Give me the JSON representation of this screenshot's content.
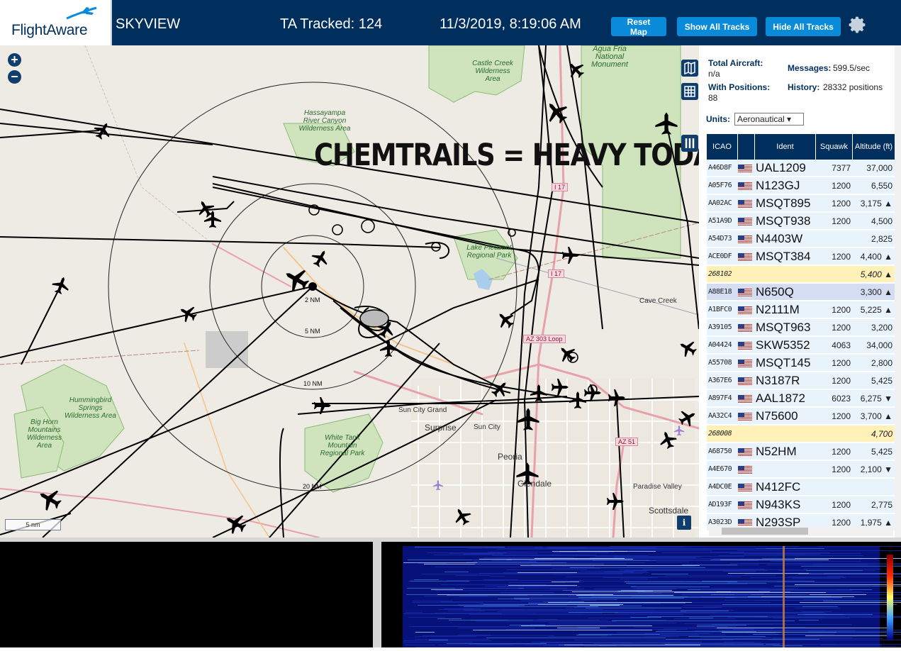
{
  "header": {
    "logo_text": "FlightAware",
    "title": "SKYVIEW",
    "tracked": "TA Tracked: 124",
    "datetime": "11/3/2019, 8:19:06 AM",
    "reset_label": "Reset Map",
    "show_label": "Show All Tracks",
    "hide_label": "Hide All Tracks",
    "accent": "#0a8bd9",
    "bg": "#002f5d"
  },
  "map": {
    "overlay_text": "CHEMTRAILS = HEAVY TODAY",
    "zoom_in": "+",
    "zoom_out": "−",
    "scale": "5 nm",
    "info": "i",
    "range_labels": [
      "2 NM",
      "5 NM",
      "10 NM",
      "20 NM"
    ],
    "places": [
      "Castle Creek Wilderness Area",
      "Hassayampa River Canyon Wilderness Area",
      "Agua Fria National Monument",
      "Lake Pleasant Regional Park",
      "Cave Creek",
      "Hummingbird Springs Wilderness Area",
      "Big Horn Mountains Wilderness Area",
      "White Tank Mountain Regional Park",
      "Sun City Grand",
      "Surprise",
      "Sun City",
      "Peoria",
      "Glendale",
      "Paradise Valley",
      "Scottsdale"
    ],
    "shields": [
      "I 17",
      "I 17",
      "AZ 303 Loop",
      "AZ 51"
    ]
  },
  "stats": {
    "total_label": "Total Aircraft:",
    "total_value": "n/a",
    "positions_label": "With Positions:",
    "positions_value": "88",
    "messages_label": "Messages:",
    "messages_value": "599.5/sec",
    "history_label": "History:",
    "history_value": "28332 positions",
    "units_label": "Units:",
    "units_value": "Aeronautical ▾"
  },
  "table": {
    "columns": [
      "ICAO",
      "",
      "Ident",
      "Squawk",
      "Altitude (ft)"
    ],
    "rows": [
      {
        "icao": "A46D8F",
        "ident": "UAL1209",
        "squawk": "7377",
        "alt": "37,000",
        "style": ""
      },
      {
        "icao": "A05F76",
        "ident": "N123GJ",
        "squawk": "1200",
        "alt": "6,550",
        "style": ""
      },
      {
        "icao": "AA02AC",
        "ident": "MSQT895",
        "squawk": "1200",
        "alt": "3,175 ▲",
        "style": ""
      },
      {
        "icao": "A51A9D",
        "ident": "MSQT938",
        "squawk": "1200",
        "alt": "4,500",
        "style": ""
      },
      {
        "icao": "A54D73",
        "ident": "N4403W",
        "squawk": "",
        "alt": "2,825",
        "style": ""
      },
      {
        "icao": "ACE0DF",
        "ident": "MSQT384",
        "squawk": "1200",
        "alt": "4,400 ▲",
        "style": ""
      },
      {
        "icao": "268102",
        "ident": "",
        "squawk": "",
        "alt": "5,400 ▲",
        "style": "yel"
      },
      {
        "icao": "A88E18",
        "ident": "N650Q",
        "squawk": "",
        "alt": "3,300 ▲",
        "style": "sel"
      },
      {
        "icao": "A1BFC0",
        "ident": "N2111M",
        "squawk": "1200",
        "alt": "5,225 ▲",
        "style": ""
      },
      {
        "icao": "A39105",
        "ident": "MSQT963",
        "squawk": "1200",
        "alt": "3,200",
        "style": ""
      },
      {
        "icao": "A04424",
        "ident": "SKW5352",
        "squawk": "4063",
        "alt": "34,000",
        "style": ""
      },
      {
        "icao": "A55708",
        "ident": "MSQT145",
        "squawk": "1200",
        "alt": "2,800",
        "style": ""
      },
      {
        "icao": "A367E6",
        "ident": "N3187R",
        "squawk": "1200",
        "alt": "5,425",
        "style": ""
      },
      {
        "icao": "A897F4",
        "ident": "AAL1872",
        "squawk": "6023",
        "alt": "6,275 ▼",
        "style": ""
      },
      {
        "icao": "AA32C4",
        "ident": "N75600",
        "squawk": "1200",
        "alt": "3,700 ▲",
        "style": ""
      },
      {
        "icao": "268008",
        "ident": "",
        "squawk": "",
        "alt": "4,700",
        "style": "yel"
      },
      {
        "icao": "A68750",
        "ident": "N52HM",
        "squawk": "1200",
        "alt": "5,425",
        "style": ""
      },
      {
        "icao": "A4E670",
        "ident": "",
        "squawk": "1200",
        "alt": "2,100 ▼",
        "style": ""
      },
      {
        "icao": "A4DC0E",
        "ident": "N412FC",
        "squawk": "",
        "alt": "",
        "style": ""
      },
      {
        "icao": "AD193F",
        "ident": "N943KS",
        "squawk": "1200",
        "alt": "2,775",
        "style": ""
      },
      {
        "icao": "A3023D",
        "ident": "N293SP",
        "squawk": "1200",
        "alt": "1,975 ▲",
        "style": ""
      }
    ]
  }
}
